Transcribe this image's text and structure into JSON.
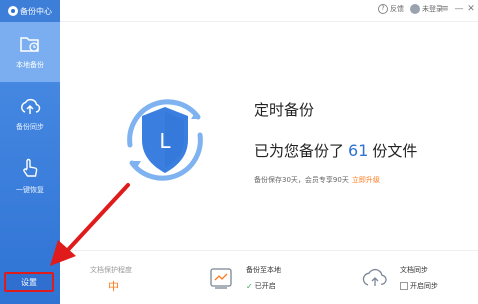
{
  "app": {
    "title": "备份中心"
  },
  "sidebar": {
    "items": [
      {
        "label": "本地备份",
        "icon": "folder-clock-icon",
        "active": true
      },
      {
        "label": "备份同步",
        "icon": "cloud-upload-icon",
        "active": false
      },
      {
        "label": "一键恢复",
        "icon": "hand-tap-icon",
        "active": false
      }
    ],
    "settings_label": "设置"
  },
  "topbar": {
    "feedback_label": "反馈",
    "login_label": "未登录",
    "menu_glyph": "≡",
    "minimize_glyph": "—",
    "close_glyph": "✕"
  },
  "main": {
    "title": "定时备份",
    "status_prefix": "已为您备份了",
    "status_count": "61",
    "status_suffix": "份文件",
    "note": "备份保存30天，会员专享90天",
    "upgrade_link": "立即升级",
    "shield_letter": "L"
  },
  "bottom": {
    "protect_label": "文档保护程度",
    "protect_value": "中",
    "local_label": "备份至本地",
    "local_status": "已开启",
    "sync_label": "文档同步",
    "sync_status": "开启同步"
  },
  "colors": {
    "sidebar": "#2f73d4",
    "accent": "#2f73d4",
    "orange": "#ff7a1a",
    "highlight": "#e01b1b"
  }
}
